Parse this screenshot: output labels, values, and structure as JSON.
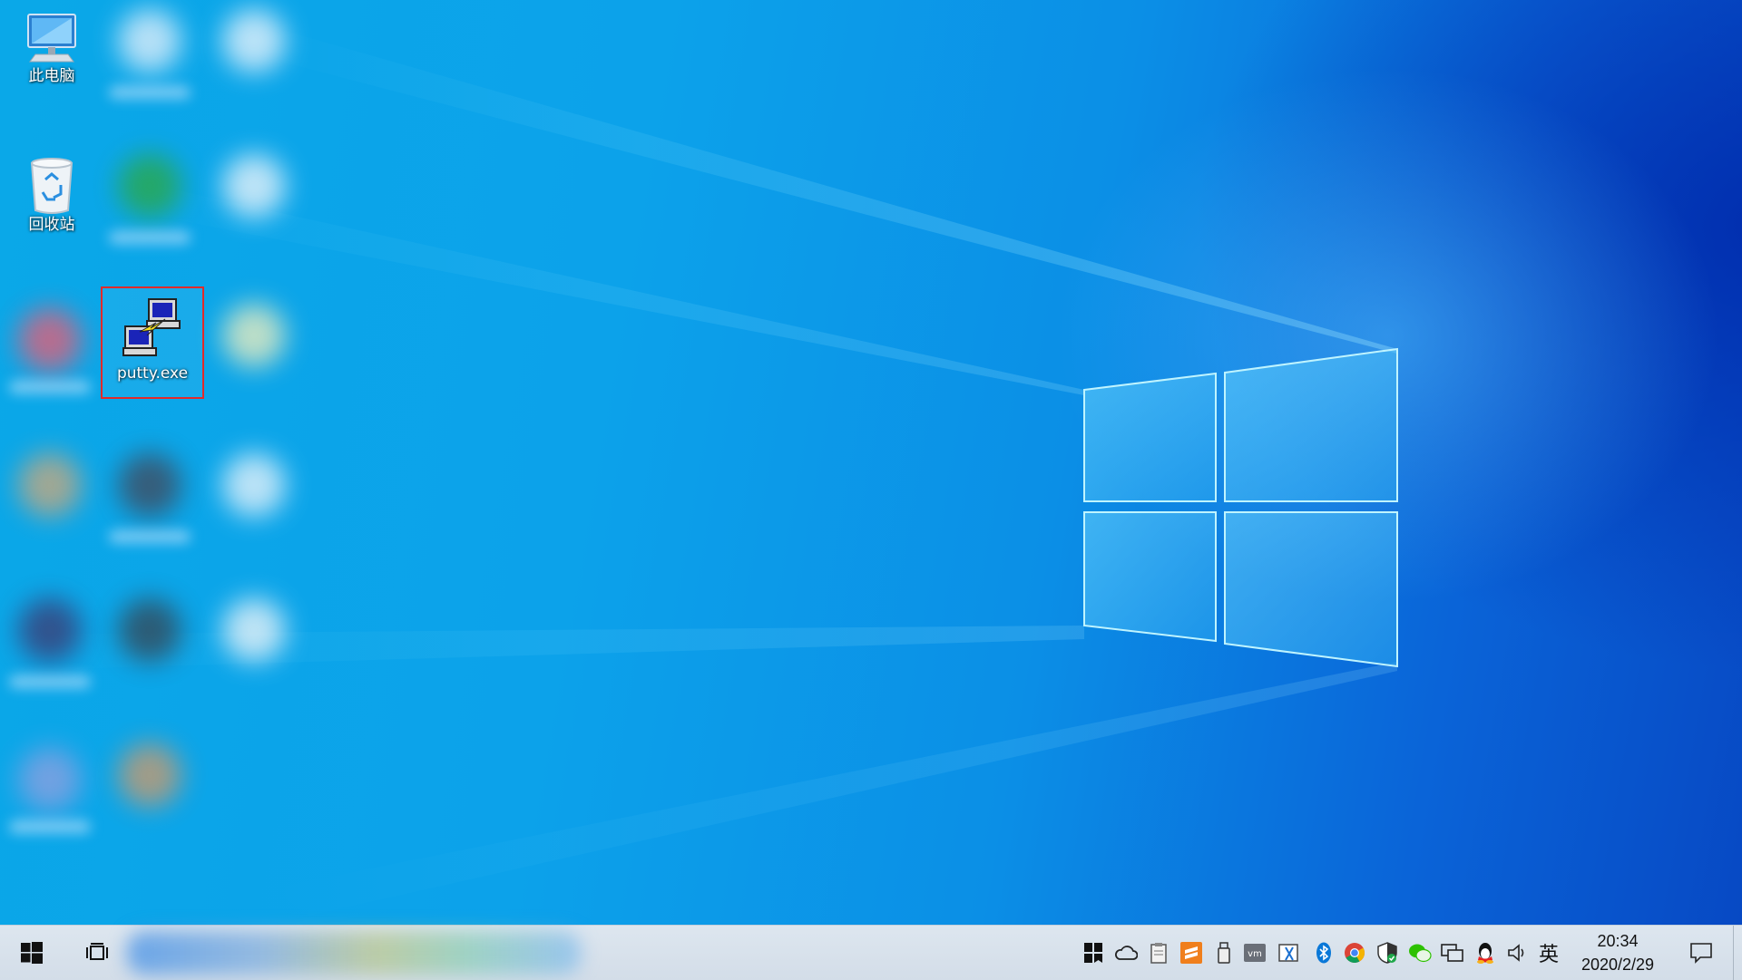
{
  "desktop": {
    "icons": [
      {
        "label": "此电脑",
        "icon": "computer-icon"
      },
      {
        "label": "回收站",
        "icon": "recycle-bin-icon"
      },
      {
        "label": "putty.exe",
        "icon": "putty-icon",
        "selected": true
      }
    ],
    "selection_color": "#e22a2a"
  },
  "taskbar": {
    "start": "windows-start-icon",
    "task_view": "task-view-icon",
    "tray": {
      "ime_label": "英",
      "icons": [
        "app-tile-icon",
        "onedrive-cloud-icon",
        "clipboard-icon",
        "sublime-icon",
        "usb-drive-icon",
        "vmware-icon",
        "snipping-tool-icon",
        "bluetooth-icon",
        "chrome-icon",
        "security-shield-icon",
        "wechat-icon",
        "network-icon",
        "qq-icon",
        "volume-icon"
      ]
    },
    "clock": {
      "time": "20:34",
      "date": "2020/2/29"
    },
    "notification": "action-center-icon"
  }
}
